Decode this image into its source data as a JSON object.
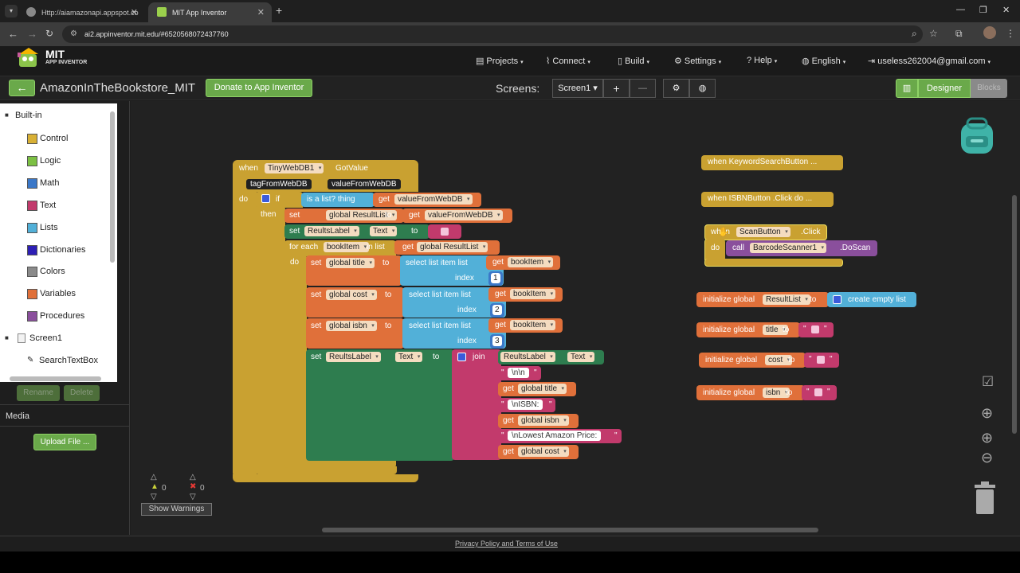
{
  "browser": {
    "tabs": [
      {
        "title": "Http://aiamazonapi.appspot.co"
      },
      {
        "title": "MIT App Inventor"
      }
    ],
    "url": "ai2.appinventor.mit.edu/#6520568072437760"
  },
  "header": {
    "logo_title": "MIT",
    "logo_subtitle": "APP INVENTOR",
    "menus": [
      "Projects",
      "Connect",
      "Build",
      "Settings",
      "Help",
      "English",
      "useless262004@gmail.com"
    ]
  },
  "toolbar": {
    "back_label": "←",
    "project_name": "AmazonInTheBookstore_MIT",
    "donate_label": "Donate to App Inventor",
    "screens_label": "Screens:",
    "screen_selected": "Screen1",
    "add_screen": "+",
    "remove_screen": "—",
    "designer_label": "Designer",
    "blocks_label": "Blocks"
  },
  "palette": {
    "builtin_label": "Built-in",
    "items": [
      {
        "label": "Control",
        "color": "#d8b035"
      },
      {
        "label": "Logic",
        "color": "#7cc043"
      },
      {
        "label": "Math",
        "color": "#3b78c8"
      },
      {
        "label": "Text",
        "color": "#c23a6c"
      },
      {
        "label": "Lists",
        "color": "#52b0d8"
      },
      {
        "label": "Dictionaries",
        "color": "#2d1fb5"
      },
      {
        "label": "Colors",
        "color": "#8a8a8a"
      },
      {
        "label": "Variables",
        "color": "#e0703a"
      },
      {
        "label": "Procedures",
        "color": "#8a4f9c"
      }
    ],
    "screen_label": "Screen1",
    "component_label": "SearchTextBox",
    "rename_label": "Rename",
    "delete_label": "Delete",
    "media_label": "Media",
    "upload_label": "Upload File ..."
  },
  "blocks": {
    "main": {
      "when": "when",
      "component": "TinyWebDB1",
      "event": "GotValue",
      "param1": "tagFromWebDB",
      "param2": "valueFromWebDB",
      "do": "do",
      "if": "if",
      "is_list": "is a list?  thing",
      "get": "get",
      "then": "then",
      "set": "set",
      "to": "to",
      "global_resultlist": "global ResultList",
      "value_from_webdb": "valueFromWebDB",
      "reultslabel": "ReultsLabel",
      "text_prop": "Text",
      "for_each": "for each",
      "bookitem": "bookItem",
      "in_list": "in list",
      "global_title": "global title",
      "global_cost": "global cost",
      "global_isbn": "global isbn",
      "select_list_item": "select list item  list",
      "index": "index",
      "idx1": "1",
      "idx2": "2",
      "idx3": "3",
      "join": "join",
      "reultslabel2": "ReultsLabel",
      "str_nn": "\\n\\n",
      "str_isbn": "\\nISBN:",
      "str_lowest": "\\nLowest Amazon Price:"
    },
    "side": {
      "keyword_search": "when  KeywordSearchButton ...",
      "isbn_click": "when  ISBNButton .Click  do ...",
      "when": "when",
      "scan_button": "ScanButton",
      "click": ".Click",
      "do": "do",
      "call": "call",
      "scanner": "BarcodeScanner1",
      "doscan": ".DoScan",
      "init_global": "initialize global",
      "resultlist": "ResultList",
      "title": "title",
      "cost": "cost",
      "isbn": "isbn",
      "to": "to",
      "create_empty_list": "create empty list"
    }
  },
  "workspace": {
    "warnings_count": "0",
    "errors_count": "0",
    "show_warnings_label": "Show Warnings"
  },
  "footer": {
    "link": "Privacy Policy and Terms of Use"
  }
}
